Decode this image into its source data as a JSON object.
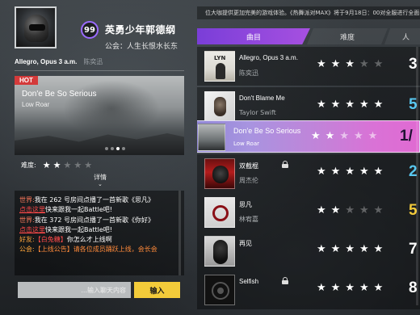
{
  "player": {
    "level": "99",
    "name": "英勇少年郭德纲",
    "guild": "公会：人生长恨水长东"
  },
  "now_playing": {
    "title": "Allegro, Opus 3 a.m.",
    "artist": "陈奕迅"
  },
  "featured": {
    "tag": "HOT",
    "title": "Don'e Be So Serious",
    "artist": "Low Roar",
    "difficulty_label": "难度:",
    "difficulty_stars": 2,
    "difficulty_max": 5,
    "details_label": "详情"
  },
  "chat": {
    "messages": [
      {
        "channel": "世界:",
        "text": "我在 262 号房间点播了一首新歌《思凡》"
      },
      {
        "link": "点击这里",
        "text": "快来跟我一起Battle吧!"
      },
      {
        "channel": "世界:",
        "text": "我在 372 号房间点播了一首新歌《你好》"
      },
      {
        "link": "点击这里",
        "text": "快来跟我一起Battle吧!"
      },
      {
        "channel": "好友:",
        "text_highlight": "【白兔糖】",
        "text": "你怎么才上线啊"
      },
      {
        "channel": "公会:",
        "text": "【上线公告】请各位成员踊跃上线，会长会"
      }
    ],
    "input_placeholder": "...输入聊天内容",
    "send_label": "输入"
  },
  "notice": "位大咖提供更加完美的游戏体验。《热舞派对MAX》将于9月18日：00对全服进行全面",
  "tabs": [
    "曲目",
    "难度",
    "人"
  ],
  "songs": [
    {
      "title": "Allegro, Opus 3 a.m.",
      "artist": "陈奕迅",
      "stars": 2.5,
      "level": "3",
      "locked": false,
      "thumb": "lyn",
      "thumb_caption": "LYN"
    },
    {
      "title": "Don't Blame Me",
      "artist": "Taylor Swift",
      "stars": 5,
      "level": "5",
      "locked": false,
      "thumb": "tay"
    },
    {
      "title": "Don'e Be So Serious",
      "artist": "Low Roar",
      "stars": 2,
      "level": "1/",
      "locked": false,
      "thumb": "roar",
      "selected": true
    },
    {
      "title": "双截棍",
      "artist": "周杰伦",
      "stars": 5,
      "level": "2",
      "locked": true,
      "thumb": "jay"
    },
    {
      "title": "思凡",
      "artist": "林宥嘉",
      "stars": 2,
      "level": "5",
      "locked": false,
      "thumb": "sif"
    },
    {
      "title": "再见",
      "artist": "",
      "stars": 5,
      "level": "7",
      "locked": false,
      "thumb": "zai"
    },
    {
      "title": "Selfish",
      "artist": "",
      "stars": 5,
      "level": "8",
      "locked": true,
      "thumb": "sel"
    }
  ],
  "colors": {
    "accent_purple": "#8a48e0",
    "send_button": "#f3cb3a",
    "level_blue": "#58c7f0",
    "level_yellow": "#f3cb3a",
    "hot_tag": "#d43a3a",
    "chat_link": "#ff4a4a"
  }
}
